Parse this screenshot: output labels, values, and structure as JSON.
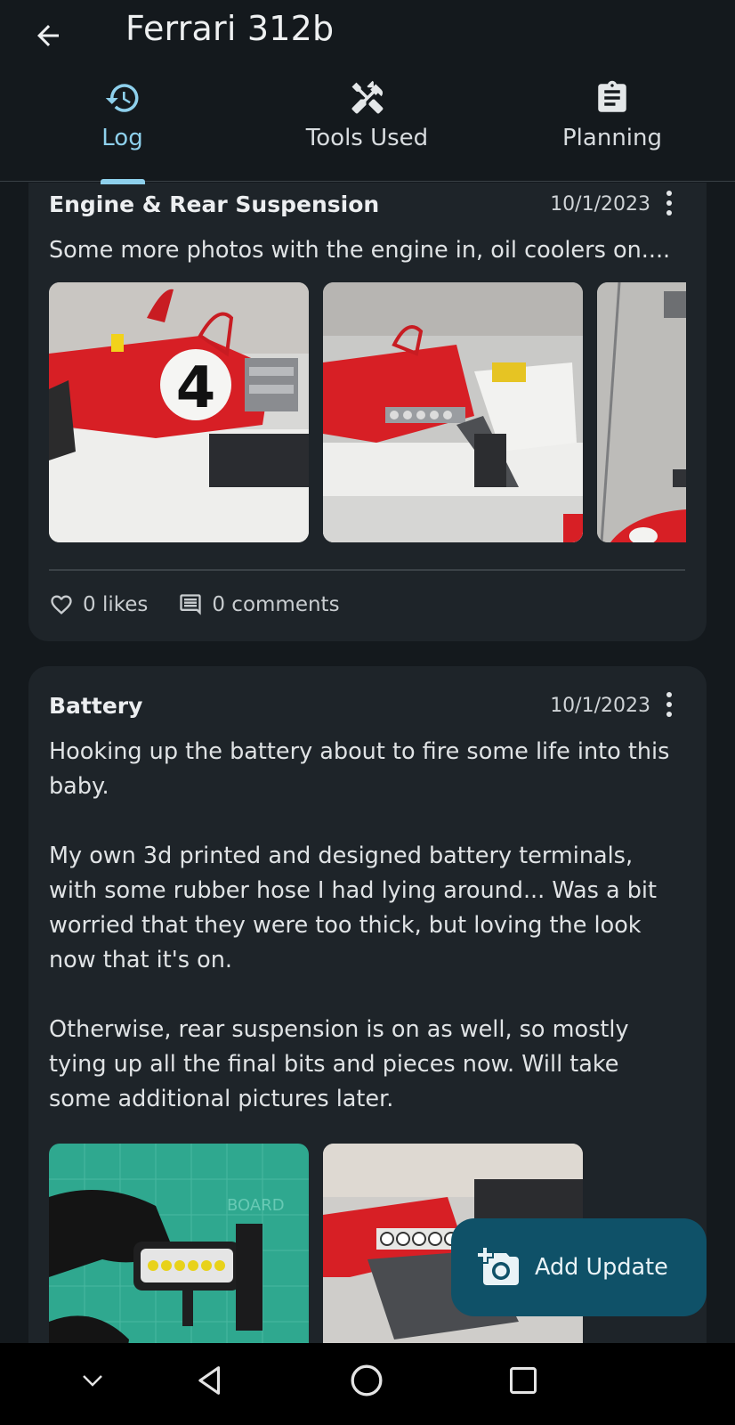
{
  "header": {
    "title": "Ferrari 312b",
    "back_icon": "arrow-left-icon"
  },
  "tabs": [
    {
      "label": "Log",
      "icon": "history-icon",
      "active": true
    },
    {
      "label": "Tools Used",
      "icon": "tools-icon",
      "active": false
    },
    {
      "label": "Planning",
      "icon": "clipboard-icon",
      "active": false
    }
  ],
  "posts": [
    {
      "title": "Engine & Rear Suspension",
      "date": "10/1/2023",
      "body": "Some more photos with the engine in, oil coolers on....",
      "photos": [
        "ferrari-red-side-number-4-photo",
        "ferrari-engine-bay-photo",
        "ferrari-partial-photo"
      ],
      "likes": "0 likes",
      "comments": "0 comments"
    },
    {
      "title": "Battery",
      "date": "10/1/2023",
      "body": "Hooking up the battery about to fire some life into this baby.\n\nMy own 3d printed and designed battery terminals, with some rubber hose I had lying around... Was a bit worried that they were too thick, but loving the look now that it's on.\n\nOtherwise, rear suspension is on as well, so mostly tying up all the final bits and pieces now. Will take some additional pictures later.",
      "photos": [
        "battery-on-cutting-mat-photo",
        "ferrari-engine-rear-photo"
      ]
    }
  ],
  "fab": {
    "label": "Add Update",
    "icon": "add-photo-icon"
  },
  "colors": {
    "background": "#14191d",
    "card": "#1e2429",
    "accent": "#8ed0ec",
    "fab": "#0f5168"
  },
  "system_nav": [
    "chevron-down-icon",
    "back-triangle-icon",
    "home-circle-icon",
    "recents-square-icon"
  ]
}
